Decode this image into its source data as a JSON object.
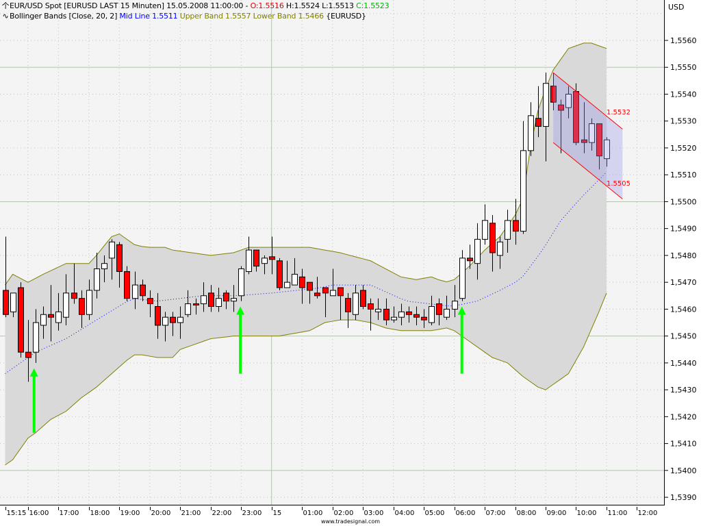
{
  "header": {
    "symbol_line": "EUR/USD Spot [EURUSD LAST 15 Minuten] 15.05.2008 11:00:00 - ",
    "open": "O:1.5516",
    "high_low": " H:1.5524 L:1.5513 ",
    "close": "C:1.5523",
    "indicator_name": "Bollinger Bands [Close, 20, 2] ",
    "mid_line": "Mid Line 1.5511",
    "bands": " Upper Band 1.5557 Lower Band 1.5466 ",
    "symbol_tag": "{EURUSD}",
    "icons": {
      "price": "candlestick-icon",
      "indicator": "wave-icon"
    }
  },
  "footer": "www.tradesignal.com",
  "colors": {
    "bull": "#ffffff",
    "bear": "#ff0000",
    "band_line": "#808000",
    "band_fill": "#d9d9d9",
    "mid": "#0000ff",
    "arrow": "#00ff00",
    "channel": "#ff0000",
    "plot_bg": "#f4f4f4"
  },
  "chart_data": {
    "type": "candlestick",
    "title": "EUR/USD Spot [EURUSD LAST 15 Minuten]",
    "ylabel": "USD",
    "ylim": [
      1.5385,
      1.558
    ],
    "y_ticks": [
      "1,5560",
      "1,5550",
      "1,5540",
      "1,5530",
      "1,5520",
      "1,5510",
      "1,5500",
      "1,5490",
      "1,5480",
      "1,5470",
      "1,5460",
      "1,5450",
      "1,5440",
      "1,5430",
      "1,5420",
      "1,5410",
      "1,5400",
      "1,5390"
    ],
    "y_tick_values": [
      1.556,
      1.555,
      1.554,
      1.553,
      1.552,
      1.551,
      1.55,
      1.549,
      1.548,
      1.547,
      1.546,
      1.545,
      1.544,
      1.543,
      1.542,
      1.541,
      1.54,
      1.539
    ],
    "x_ticks": [
      {
        "bar": 0,
        "label": "15:15"
      },
      {
        "bar": 3,
        "label": "16:00"
      },
      {
        "bar": 7,
        "label": "17:00"
      },
      {
        "bar": 11,
        "label": "18:00"
      },
      {
        "bar": 15,
        "label": "19:00"
      },
      {
        "bar": 19,
        "label": "20:00"
      },
      {
        "bar": 23,
        "label": "21:00"
      },
      {
        "bar": 27,
        "label": "22:00"
      },
      {
        "bar": 31,
        "label": "23:00"
      },
      {
        "bar": 35,
        "label": "15"
      },
      {
        "bar": 39,
        "label": "01:00"
      },
      {
        "bar": 43,
        "label": "02:00"
      },
      {
        "bar": 47,
        "label": "03:00"
      },
      {
        "bar": 51,
        "label": "04:00"
      },
      {
        "bar": 55,
        "label": "05:00"
      },
      {
        "bar": 59,
        "label": "06:00"
      },
      {
        "bar": 63,
        "label": "07:00"
      },
      {
        "bar": 67,
        "label": "08:00"
      },
      {
        "bar": 71,
        "label": "09:00"
      },
      {
        "bar": 75,
        "label": "10:00"
      },
      {
        "bar": 79,
        "label": "11:00"
      },
      {
        "bar": 83,
        "label": "12:00"
      }
    ],
    "ohlc_fields": [
      "open",
      "high",
      "low",
      "close"
    ],
    "ohlc": [
      [
        1.5467,
        1.5487,
        1.5457,
        1.5458
      ],
      [
        1.5459,
        1.5466,
        1.5457,
        1.5466
      ],
      [
        1.5468,
        1.547,
        1.5442,
        1.5444
      ],
      [
        1.5444,
        1.5456,
        1.5433,
        1.5442
      ],
      [
        1.5444,
        1.546,
        1.544,
        1.5455
      ],
      [
        1.5454,
        1.5461,
        1.5449,
        1.5458
      ],
      [
        1.5458,
        1.5469,
        1.5448,
        1.5457
      ],
      [
        1.5455,
        1.5466,
        1.5452,
        1.5459
      ],
      [
        1.5457,
        1.5473,
        1.5454,
        1.5466
      ],
      [
        1.5466,
        1.5477,
        1.5462,
        1.5464
      ],
      [
        1.5464,
        1.5467,
        1.5453,
        1.5458
      ],
      [
        1.5458,
        1.5471,
        1.5456,
        1.5467
      ],
      [
        1.5467,
        1.5481,
        1.5464,
        1.5475
      ],
      [
        1.5475,
        1.548,
        1.547,
        1.5477
      ],
      [
        1.5479,
        1.5486,
        1.5471,
        1.5485
      ],
      [
        1.5484,
        1.5485,
        1.5468,
        1.5474
      ],
      [
        1.5474,
        1.5476,
        1.5463,
        1.5464
      ],
      [
        1.5464,
        1.5474,
        1.546,
        1.5469
      ],
      [
        1.5469,
        1.5471,
        1.5463,
        1.5465
      ],
      [
        1.5464,
        1.5467,
        1.5457,
        1.5462
      ],
      [
        1.5461,
        1.5466,
        1.5449,
        1.5454
      ],
      [
        1.5454,
        1.5459,
        1.5448,
        1.5457
      ],
      [
        1.5457,
        1.5459,
        1.545,
        1.5455
      ],
      [
        1.5455,
        1.5461,
        1.5449,
        1.5457
      ],
      [
        1.5458,
        1.5467,
        1.5457,
        1.5462
      ],
      [
        1.5462,
        1.5464,
        1.5458,
        1.54615
      ],
      [
        1.5462,
        1.547,
        1.5459,
        1.5465
      ],
      [
        1.5466,
        1.5469,
        1.5459,
        1.5461
      ],
      [
        1.5461,
        1.5468,
        1.5459,
        1.5464
      ],
      [
        1.5466,
        1.5467,
        1.546,
        1.5463
      ],
      [
        1.5463,
        1.5469,
        1.5459,
        1.5464
      ],
      [
        1.5465,
        1.5476,
        1.5463,
        1.5475
      ],
      [
        1.5474,
        1.5487,
        1.5473,
        1.5482
      ],
      [
        1.5482,
        1.5482,
        1.5474,
        1.5476
      ],
      [
        1.5477,
        1.548,
        1.5473,
        1.5479
      ],
      [
        1.54795,
        1.5487,
        1.5473,
        1.54785
      ],
      [
        1.5478,
        1.5479,
        1.5467,
        1.5468
      ],
      [
        1.5468,
        1.5478,
        1.5468,
        1.547
      ],
      [
        1.5469,
        1.5479,
        1.5469,
        1.5473
      ],
      [
        1.5472,
        1.5475,
        1.5462,
        1.5468
      ],
      [
        1.547,
        1.547,
        1.5462,
        1.5467
      ],
      [
        1.5466,
        1.5472,
        1.5464,
        1.5465
      ],
      [
        1.5468,
        1.5468,
        1.5457,
        1.5466
      ],
      [
        1.5465,
        1.5475,
        1.5465,
        1.5467
      ],
      [
        1.5468,
        1.5468,
        1.5456,
        1.5465
      ],
      [
        1.5464,
        1.5466,
        1.5453,
        1.5459
      ],
      [
        1.5458,
        1.5469,
        1.5456,
        1.5466
      ],
      [
        1.5467,
        1.5469,
        1.546,
        1.5461
      ],
      [
        1.5462,
        1.5464,
        1.5452,
        1.546
      ],
      [
        1.5459,
        1.5464,
        1.5456,
        1.546
      ],
      [
        1.546,
        1.5464,
        1.5454,
        1.5456
      ],
      [
        1.5456,
        1.5461,
        1.5455,
        1.5457
      ],
      [
        1.5457,
        1.5462,
        1.5454,
        1.5459
      ],
      [
        1.5459,
        1.5461,
        1.5455,
        1.5458
      ],
      [
        1.5458,
        1.5461,
        1.5454,
        1.5457
      ],
      [
        1.5457,
        1.546,
        1.5453,
        1.5456
      ],
      [
        1.5455,
        1.5465,
        1.5454,
        1.5461
      ],
      [
        1.5462,
        1.5464,
        1.5454,
        1.5458
      ],
      [
        1.5457,
        1.5465,
        1.5456,
        1.546
      ],
      [
        1.546,
        1.5469,
        1.5457,
        1.5463
      ],
      [
        1.5464,
        1.5482,
        1.5463,
        1.5479
      ],
      [
        1.5479,
        1.5484,
        1.5475,
        1.5478
      ],
      [
        1.5477,
        1.5492,
        1.5471,
        1.5486
      ],
      [
        1.5486,
        1.5499,
        1.5484,
        1.5493
      ],
      [
        1.5492,
        1.5495,
        1.5474,
        1.5481
      ],
      [
        1.548,
        1.5487,
        1.5475,
        1.5485
      ],
      [
        1.5486,
        1.5497,
        1.5481,
        1.5493
      ],
      [
        1.5493,
        1.5501,
        1.5484,
        1.5489
      ],
      [
        1.5489,
        1.553,
        1.5488,
        1.5519
      ],
      [
        1.5519,
        1.5537,
        1.5517,
        1.5532
      ],
      [
        1.5531,
        1.5543,
        1.5524,
        1.5528
      ],
      [
        1.5528,
        1.5548,
        1.5515,
        1.5544
      ],
      [
        1.5543,
        1.5548,
        1.5534,
        1.5537
      ],
      [
        1.5536,
        1.5538,
        1.5518,
        1.5534
      ],
      [
        1.5535,
        1.5543,
        1.5531,
        1.554
      ],
      [
        1.5541,
        1.5544,
        1.5521,
        1.5522
      ],
      [
        1.5523,
        1.5537,
        1.5518,
        1.5522
      ],
      [
        1.5522,
        1.5531,
        1.5519,
        1.5529
      ],
      [
        1.5529,
        1.5529,
        1.5512,
        1.5517
      ],
      [
        1.5516,
        1.5524,
        1.5513,
        1.5523
      ]
    ],
    "bollinger": {
      "upper": [
        [
          0,
          1.5469
        ],
        [
          1,
          1.5473
        ],
        [
          3,
          1.547
        ],
        [
          5,
          1.5473
        ],
        [
          8,
          1.5477
        ],
        [
          11,
          1.5477
        ],
        [
          12,
          1.548
        ],
        [
          13.4,
          1.5485
        ],
        [
          14,
          1.5487
        ],
        [
          15,
          1.5488
        ],
        [
          17,
          1.5484
        ],
        [
          18.5,
          1.5483
        ],
        [
          21,
          1.5483
        ],
        [
          22,
          1.5482
        ],
        [
          27,
          1.548
        ],
        [
          30,
          1.5481
        ],
        [
          32,
          1.5483
        ],
        [
          36,
          1.5483
        ],
        [
          40,
          1.5483
        ],
        [
          44,
          1.5481
        ],
        [
          48,
          1.5478
        ],
        [
          52,
          1.5472
        ],
        [
          54,
          1.5471
        ],
        [
          56,
          1.5472
        ],
        [
          57.8,
          1.547
        ],
        [
          59,
          1.5471
        ],
        [
          61,
          1.5476
        ],
        [
          63,
          1.5482
        ],
        [
          65,
          1.5487
        ],
        [
          67,
          1.5495
        ],
        [
          68,
          1.5501
        ],
        [
          69,
          1.552
        ],
        [
          70,
          1.5534
        ],
        [
          71,
          1.5542
        ],
        [
          72,
          1.5549
        ],
        [
          73,
          1.5553
        ],
        [
          74,
          1.5557
        ],
        [
          76,
          1.5559
        ],
        [
          77,
          1.5559
        ],
        [
          79,
          1.5557
        ]
      ],
      "lower": [
        [
          0,
          1.5402
        ],
        [
          1,
          1.5404
        ],
        [
          3,
          1.5412
        ],
        [
          4,
          1.5414
        ],
        [
          6,
          1.5419
        ],
        [
          8,
          1.5422
        ],
        [
          10,
          1.5427
        ],
        [
          12,
          1.5431
        ],
        [
          14,
          1.5436
        ],
        [
          16,
          1.5441
        ],
        [
          17,
          1.5443
        ],
        [
          18,
          1.5443
        ],
        [
          20,
          1.5442
        ],
        [
          22,
          1.5442
        ],
        [
          23,
          1.5445
        ],
        [
          25,
          1.5447
        ],
        [
          27,
          1.5449
        ],
        [
          30,
          1.545
        ],
        [
          36,
          1.545
        ],
        [
          40,
          1.5452
        ],
        [
          42,
          1.5455
        ],
        [
          44,
          1.5456
        ],
        [
          46,
          1.5456
        ],
        [
          48,
          1.5455
        ],
        [
          50,
          1.5453
        ],
        [
          52,
          1.5452
        ],
        [
          56,
          1.5452
        ],
        [
          58,
          1.5453
        ],
        [
          59,
          1.5452
        ],
        [
          60,
          1.545
        ],
        [
          62,
          1.5446
        ],
        [
          64,
          1.5442
        ],
        [
          66,
          1.544
        ],
        [
          68,
          1.5435
        ],
        [
          70,
          1.5431
        ],
        [
          71,
          1.543
        ],
        [
          72,
          1.5432
        ],
        [
          74,
          1.5436
        ],
        [
          76,
          1.5446
        ],
        [
          78,
          1.5459
        ],
        [
          79,
          1.5466
        ]
      ],
      "mid": [
        [
          0,
          1.5436
        ],
        [
          1,
          1.5438
        ],
        [
          4,
          1.5444
        ],
        [
          8,
          1.5449
        ],
        [
          12.6,
          1.5457
        ],
        [
          15.5,
          1.5462
        ],
        [
          16.7,
          1.5464
        ],
        [
          20,
          1.5463
        ],
        [
          23,
          1.5464
        ],
        [
          26,
          1.5465
        ],
        [
          30.5,
          1.5465
        ],
        [
          35,
          1.5466
        ],
        [
          41.6,
          1.5468
        ],
        [
          43,
          1.5469
        ],
        [
          48,
          1.5469
        ],
        [
          52.7,
          1.5463
        ],
        [
          58.7,
          1.5461
        ],
        [
          62,
          1.5463
        ],
        [
          65,
          1.5467
        ],
        [
          67.7,
          1.5471
        ],
        [
          70.6,
          1.5482
        ],
        [
          73,
          1.5493
        ],
        [
          75.5,
          1.5501
        ],
        [
          79,
          1.5511
        ]
      ]
    },
    "channel": {
      "start_bar": 72,
      "end_bar": 81.1,
      "upper": [
        1.5548,
        1.5527
      ],
      "lower": [
        1.5522,
        1.5501
      ],
      "upper_label": "1.5532",
      "lower_label": "1.5505"
    },
    "arrows": [
      {
        "bar": 3.8,
        "from": 1.5414,
        "to": 1.5438
      },
      {
        "bar": 30.9,
        "from": 1.5436,
        "to": 1.5461
      },
      {
        "bar": 60.0,
        "from": 1.5436,
        "to": 1.5461
      }
    ],
    "solid_gridlines": [
      1.555,
      1.55,
      1.545,
      1.54
    ],
    "dotted_gridlines": [
      1.557,
      1.556,
      1.554,
      1.553,
      1.552,
      1.551,
      1.549,
      1.548,
      1.547,
      1.546,
      1.544,
      1.543,
      1.542,
      1.541,
      1.539
    ],
    "session_break_bar": 35
  }
}
